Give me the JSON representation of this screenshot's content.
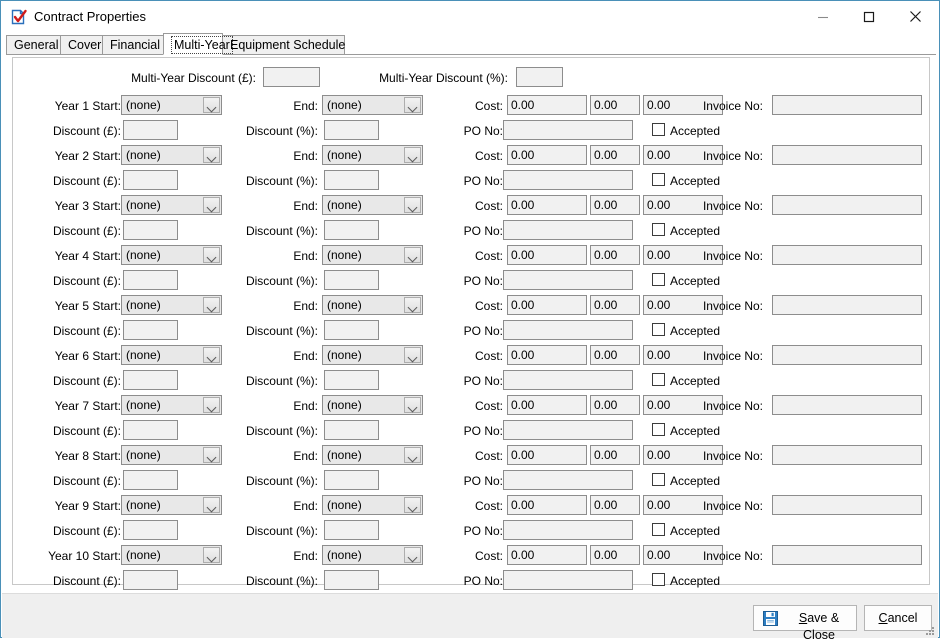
{
  "window": {
    "title": "Contract Properties",
    "icon": "document-check-icon",
    "controls": {
      "minimize": "minimize-icon",
      "maximize": "maximize-icon",
      "close": "close-icon"
    },
    "border_color": "#4a90b8"
  },
  "tabs": [
    {
      "label": "General",
      "selected": false
    },
    {
      "label": "Cover",
      "selected": false
    },
    {
      "label": "Financial",
      "selected": false
    },
    {
      "label": "Multi-Year",
      "selected": true
    },
    {
      "label": "Equipment Schedule",
      "selected": false
    }
  ],
  "header": {
    "discount_pounds_label": "Multi-Year Discount (£):",
    "discount_pounds_value": "",
    "discount_percent_label": "Multi-Year Discount (%):",
    "discount_percent_value": ""
  },
  "column_labels": {
    "end": "End:",
    "cost": "Cost:",
    "invoice_no": "Invoice No:",
    "discount_pounds": "Discount (£):",
    "discount_percent": "Discount (%):",
    "po_no": "PO No:",
    "accepted": "Accepted"
  },
  "combo_placeholder": "(none)",
  "cost_default": "0.00",
  "years": [
    {
      "start_label": "Year 1 Start:",
      "start_value": "(none)",
      "end_value": "(none)",
      "cost1": "0.00",
      "cost2": "0.00",
      "cost3": "0.00",
      "invoice_no": "",
      "discount_pounds": "",
      "discount_percent": "",
      "po_no": "",
      "accepted": false
    },
    {
      "start_label": "Year 2 Start:",
      "start_value": "(none)",
      "end_value": "(none)",
      "cost1": "0.00",
      "cost2": "0.00",
      "cost3": "0.00",
      "invoice_no": "",
      "discount_pounds": "",
      "discount_percent": "",
      "po_no": "",
      "accepted": false
    },
    {
      "start_label": "Year 3 Start:",
      "start_value": "(none)",
      "end_value": "(none)",
      "cost1": "0.00",
      "cost2": "0.00",
      "cost3": "0.00",
      "invoice_no": "",
      "discount_pounds": "",
      "discount_percent": "",
      "po_no": "",
      "accepted": false
    },
    {
      "start_label": "Year 4 Start:",
      "start_value": "(none)",
      "end_value": "(none)",
      "cost1": "0.00",
      "cost2": "0.00",
      "cost3": "0.00",
      "invoice_no": "",
      "discount_pounds": "",
      "discount_percent": "",
      "po_no": "",
      "accepted": false
    },
    {
      "start_label": "Year 5 Start:",
      "start_value": "(none)",
      "end_value": "(none)",
      "cost1": "0.00",
      "cost2": "0.00",
      "cost3": "0.00",
      "invoice_no": "",
      "discount_pounds": "",
      "discount_percent": "",
      "po_no": "",
      "accepted": false
    },
    {
      "start_label": "Year 6 Start:",
      "start_value": "(none)",
      "end_value": "(none)",
      "cost1": "0.00",
      "cost2": "0.00",
      "cost3": "0.00",
      "invoice_no": "",
      "discount_pounds": "",
      "discount_percent": "",
      "po_no": "",
      "accepted": false
    },
    {
      "start_label": "Year 7 Start:",
      "start_value": "(none)",
      "end_value": "(none)",
      "cost1": "0.00",
      "cost2": "0.00",
      "cost3": "0.00",
      "invoice_no": "",
      "discount_pounds": "",
      "discount_percent": "",
      "po_no": "",
      "accepted": false
    },
    {
      "start_label": "Year 8 Start:",
      "start_value": "(none)",
      "end_value": "(none)",
      "cost1": "0.00",
      "cost2": "0.00",
      "cost3": "0.00",
      "invoice_no": "",
      "discount_pounds": "",
      "discount_percent": "",
      "po_no": "",
      "accepted": false
    },
    {
      "start_label": "Year 9 Start:",
      "start_value": "(none)",
      "end_value": "(none)",
      "cost1": "0.00",
      "cost2": "0.00",
      "cost3": "0.00",
      "invoice_no": "",
      "discount_pounds": "",
      "discount_percent": "",
      "po_no": "",
      "accepted": false
    },
    {
      "start_label": "Year 10 Start:",
      "start_value": "(none)",
      "end_value": "(none)",
      "cost1": "0.00",
      "cost2": "0.00",
      "cost3": "0.00",
      "invoice_no": "",
      "discount_pounds": "",
      "discount_percent": "",
      "po_no": "",
      "accepted": false
    }
  ],
  "footer": {
    "save_label_prefix": "S",
    "save_label_rest": "ave & Close",
    "save_icon": "save-floppy-icon",
    "cancel_label_prefix": "C",
    "cancel_label_rest": "ancel",
    "resize_grip": "resize-grip-icon"
  }
}
